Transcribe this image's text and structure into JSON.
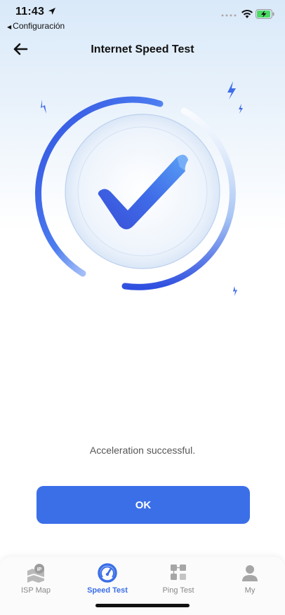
{
  "status_bar": {
    "time": "11:43",
    "back_app_label": "Configuración",
    "icons": [
      "location-arrow-icon",
      "signal-dots-icon",
      "wifi-icon",
      "battery-charging-icon"
    ]
  },
  "header": {
    "title": "Internet Speed Test",
    "back_icon": "arrow-left-icon"
  },
  "hero": {
    "icon": "checkmark-icon",
    "decor_icons": [
      "lightning-icon"
    ]
  },
  "result": {
    "message": "Acceleration successful."
  },
  "ok_button": {
    "label": "OK"
  },
  "tab_bar": {
    "items": [
      {
        "label": "ISP Map",
        "icon": "isp-map-icon",
        "active": false
      },
      {
        "label": "Speed Test",
        "icon": "speedometer-icon",
        "active": true
      },
      {
        "label": "Ping Test",
        "icon": "ping-grid-icon",
        "active": false
      },
      {
        "label": "My",
        "icon": "user-icon",
        "active": false
      }
    ]
  },
  "colors": {
    "accent": "#3b6fe8",
    "arc_blue": "#3f5fe6",
    "inactive_tab": "#888888"
  }
}
